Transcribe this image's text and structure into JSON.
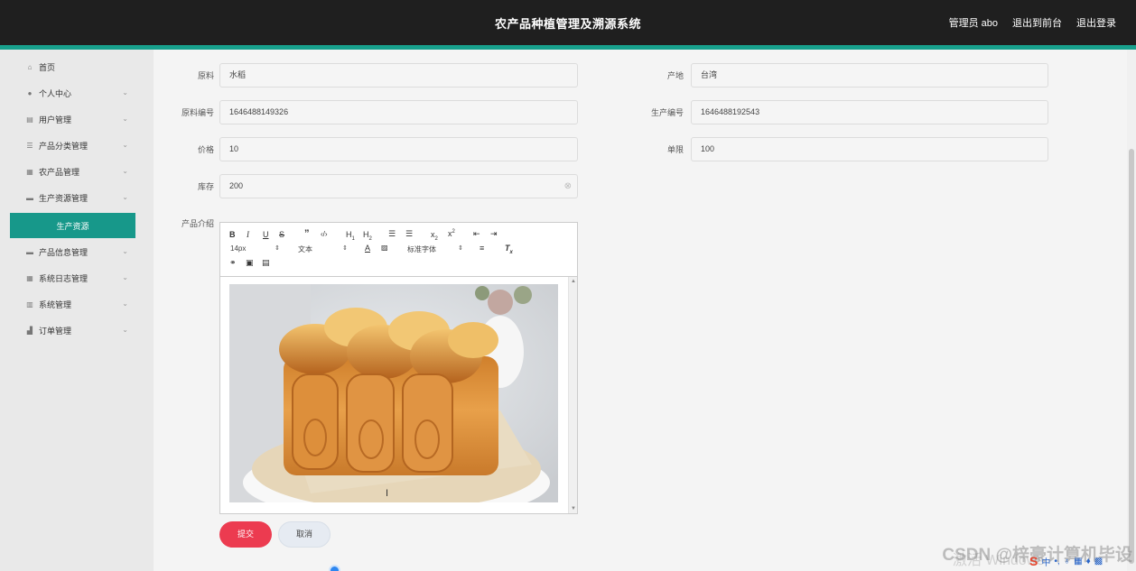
{
  "header": {
    "title": "农产品种植管理及溯源系统",
    "links": [
      "管理员 abo",
      "退出到前台",
      "退出登录"
    ]
  },
  "sidebar": {
    "items": [
      {
        "label": "首页",
        "icon": "home-icon",
        "glyph": "⌂",
        "expandable": false
      },
      {
        "label": "个人中心",
        "icon": "user-icon",
        "glyph": "●",
        "expandable": true
      },
      {
        "label": "用户管理",
        "icon": "users-icon",
        "glyph": "▤",
        "expandable": true
      },
      {
        "label": "产品分类管理",
        "icon": "list-icon",
        "glyph": "☰",
        "expandable": true
      },
      {
        "label": "农产品管理",
        "icon": "grid-icon",
        "glyph": "▦",
        "expandable": true
      },
      {
        "label": "生产资源管理",
        "icon": "briefcase-icon",
        "glyph": "▬",
        "expandable": true
      }
    ],
    "active_sub": "生产资源",
    "items_after": [
      {
        "label": "产品信息管理",
        "icon": "chat-icon",
        "glyph": "▬",
        "expandable": true
      },
      {
        "label": "系统日志管理",
        "icon": "grid-icon",
        "glyph": "▦",
        "expandable": true
      },
      {
        "label": "系统管理",
        "icon": "bar-chart-icon",
        "glyph": "▥",
        "expandable": true
      },
      {
        "label": "订单管理",
        "icon": "chart-icon",
        "glyph": "▟",
        "expandable": true
      }
    ]
  },
  "form": {
    "left": [
      {
        "label": "原料",
        "value": "水稻"
      },
      {
        "label": "原料编号",
        "value": "1646488149326"
      },
      {
        "label": "价格",
        "value": "10"
      },
      {
        "label": "库存",
        "value": "200"
      }
    ],
    "right": [
      {
        "label": "产地",
        "value": "台湾"
      },
      {
        "label": "生产编号",
        "value": "1646488192543"
      },
      {
        "label": "单限",
        "value": "100"
      }
    ],
    "intro_label": "产品介绍",
    "editor": {
      "font_size": "14px",
      "text_type": "文本",
      "font_family": "标准字体"
    },
    "submit": "提交",
    "cancel": "取消"
  },
  "watermark": "CSDN @梓豪计算机毕设",
  "activation": "激活 Windows",
  "colors": {
    "accent": "#17a08c",
    "active_menu": "#17988a",
    "submit": "#ec3b50",
    "topbar": "#1f1f1f"
  }
}
